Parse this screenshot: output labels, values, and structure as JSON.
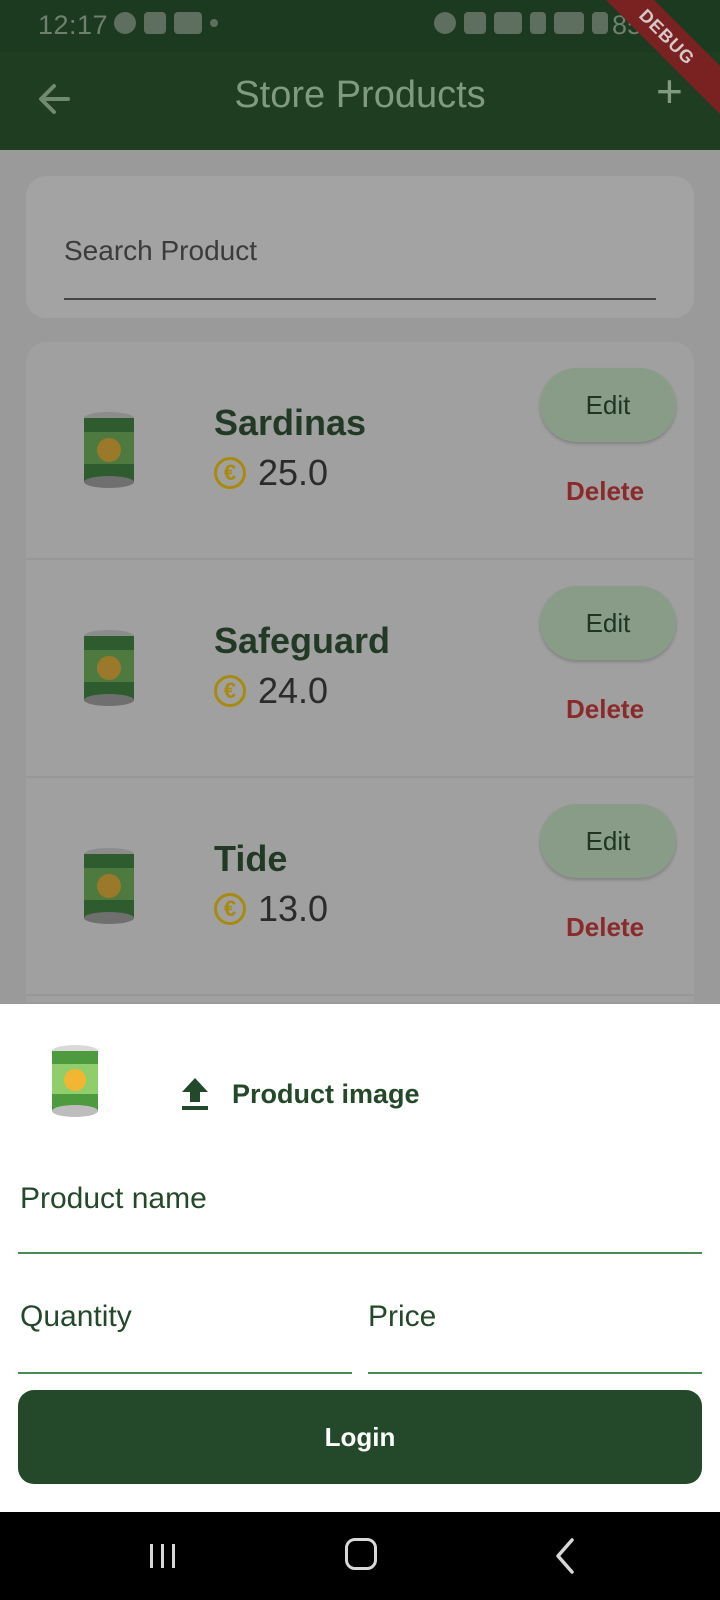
{
  "status_bar": {
    "time": "12:17",
    "battery": "85%"
  },
  "app_bar": {
    "title": "Store Products",
    "debug_banner": "DEBUG"
  },
  "search": {
    "placeholder": "Search Product"
  },
  "products": [
    {
      "name": "Sardinas",
      "price": "25.0",
      "edit_label": "Edit",
      "delete_label": "Delete"
    },
    {
      "name": "Safeguard",
      "price": "24.0",
      "edit_label": "Edit",
      "delete_label": "Delete"
    },
    {
      "name": "Tide",
      "price": "13.0",
      "edit_label": "Edit",
      "delete_label": "Delete"
    }
  ],
  "currency_icon": "euro-coin-icon",
  "sheet": {
    "upload_label": "Product image",
    "product_name_label": "Product name",
    "quantity_label": "Quantity",
    "price_label": "Price",
    "submit_label": "Login"
  },
  "colors": {
    "primary": "#24492a",
    "delete": "#c0392b",
    "coin": "#e8b81a",
    "field_underline": "#4a8a55"
  }
}
